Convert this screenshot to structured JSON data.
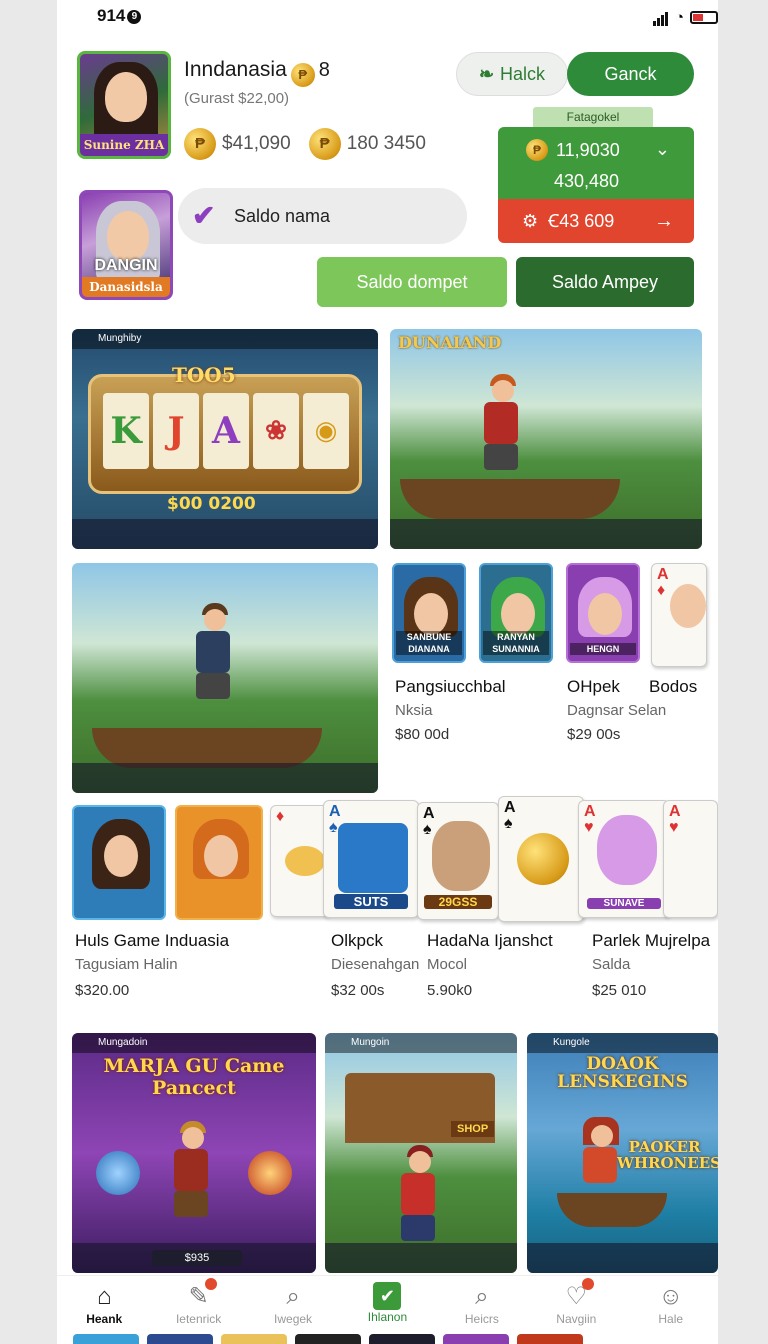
{
  "status": {
    "time": "914",
    "badge": "9"
  },
  "profile": {
    "name": "Inndanasia",
    "level": "8",
    "subtitle": "(Gurast $22,00)",
    "balance1": "$41,090",
    "balance2": "180 3450",
    "avatar_label": "Sunine ZHA",
    "avatar2_title": "DANGIN",
    "avatar2_label": "Danasidsla"
  },
  "header": {
    "hack_label": "Halck",
    "gank_label": "Ganck"
  },
  "wallet_panel": {
    "label": "Fatagokel",
    "coin_value": "11,9030",
    "secondary_value": "430,480",
    "red_value": "Ꞓ43 609"
  },
  "search": {
    "placeholder": "Saldo nama"
  },
  "actions": {
    "dompet_label": "Saldo dompet",
    "ampey_label": "Saldo Ampey"
  },
  "games": {
    "slot": {
      "top_label": "Munghiby",
      "logo": "TOO5",
      "reels": [
        "K",
        "J",
        "A"
      ],
      "win": "$00 0200"
    },
    "fishing": {
      "title": "DUNAIAND"
    },
    "row1": [
      {
        "name": "Pangsiucchbal",
        "sub": "Nksia",
        "price": "$80 00d",
        "card_label": "SANBUNE DIANANA"
      },
      {
        "name": "OHpek",
        "sub": "Dagnsar Selan",
        "price": "$29 00s",
        "card_label": "RANYAN SUNANNIA"
      },
      {
        "name": "Bodos",
        "sub": "",
        "price": "",
        "card_label": "HENGN"
      }
    ],
    "row2": [
      {
        "name": "Huls Game Induasia",
        "sub": "Tagusiam Halin",
        "price": "$320.00"
      },
      {
        "name": "Olkpck",
        "sub": "Diesenahgan",
        "price": "$32 00s",
        "card_label": "SUTS"
      },
      {
        "name": "HadaNa Ijanshct",
        "sub": "Mocol",
        "price": "5.90k0",
        "card_label": "29GSS"
      },
      {
        "name": "Parlek Mujrelpa",
        "sub": "Salda",
        "price": "$25 010",
        "card_label": "SUNAVE"
      }
    ]
  },
  "banners": [
    {
      "title": "MARJA GU Came Pancect",
      "top_label": "Mungadoin",
      "price": "$935"
    },
    {
      "title": "SHOP",
      "top_label": "Mungoin"
    },
    {
      "title": "DOAOK LENSKEGINS",
      "subtitle": "PAOKER WHRONEES",
      "top_label": "Kungole"
    }
  ],
  "tabbar": [
    {
      "label": "Heank",
      "icon": "home-icon"
    },
    {
      "label": "Ietenrick",
      "icon": "edit-icon"
    },
    {
      "label": "Iwegek",
      "icon": "search-icon"
    },
    {
      "label": "Ihlanon",
      "icon": "check-icon"
    },
    {
      "label": "Heicrs",
      "icon": "search-icon"
    },
    {
      "label": "Navgiin",
      "icon": "heart-icon"
    },
    {
      "label": "Hale",
      "icon": "user-icon"
    }
  ],
  "colors": {
    "accent": "#2e8b39",
    "danger": "#e1452e",
    "light_green": "#7cc65a"
  }
}
